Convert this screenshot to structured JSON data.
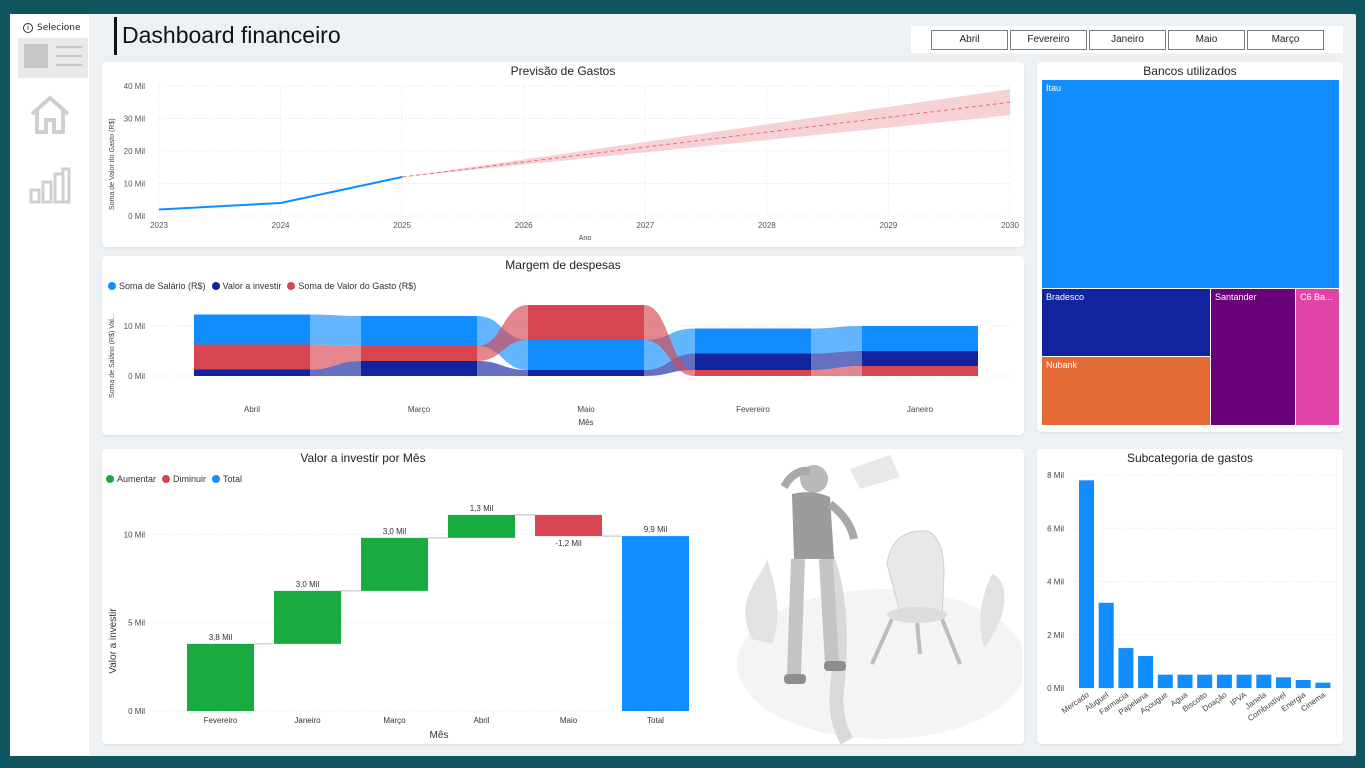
{
  "sidebar": {
    "select_label": "Selecione",
    "icons": [
      "home-icon",
      "bar-chart-icon"
    ]
  },
  "header": {
    "title": "Dashboard financeiro"
  },
  "month_filter": [
    "Abril",
    "Fevereiro",
    "Janeiro",
    "Maio",
    "Março"
  ],
  "chart_data": [
    {
      "id": "forecast",
      "type": "line",
      "title": "Previsão de Gastos",
      "xlabel": "Ano",
      "ylabel": "Soma de Valor do Gasto (R$)",
      "x": [
        2023,
        2024,
        2025
      ],
      "values": [
        2,
        4,
        12
      ],
      "forecast": {
        "x": [
          2025,
          2030
        ],
        "values": [
          12,
          35
        ],
        "lower": [
          12,
          31
        ],
        "upper": [
          12,
          39
        ]
      },
      "xticks": [
        "2023",
        "2024",
        "2025",
        "2026",
        "2027",
        "2028",
        "2029",
        "2030"
      ],
      "yticks": [
        "0 Mil",
        "10 Mil",
        "20 Mil",
        "30 Mil",
        "40 Mil"
      ],
      "ylim": [
        0,
        40
      ],
      "colors": {
        "line": "#118dff",
        "forecast": "#e66c7a",
        "band": "#f4c7cc"
      }
    },
    {
      "id": "ribbon",
      "type": "area",
      "title": "Margem de despesas",
      "xlabel": "Mês",
      "ylabel": "Soma de Salário (R$) Val...",
      "categories": [
        "Abril",
        "Março",
        "Maio",
        "Fevereiro",
        "Janeiro"
      ],
      "series": [
        {
          "name": "Soma de Salário (R$)",
          "color": "#118dff",
          "values": [
            6,
            6,
            6,
            5,
            5
          ]
        },
        {
          "name": "Valor a investir",
          "color": "#12239e",
          "values": [
            1.3,
            3,
            1.2,
            3.3,
            3
          ]
        },
        {
          "name": "Soma de Valor do Gasto (R$)",
          "color": "#d64550",
          "values": [
            5,
            3,
            7,
            1.2,
            2
          ]
        }
      ],
      "yticks": [
        "0 Mil",
        "10 Mil"
      ],
      "ylim": [
        -2,
        13
      ]
    },
    {
      "id": "waterfall",
      "type": "bar",
      "title": "Valor a investir por Mês",
      "xlabel": "Mês",
      "ylabel": "Valor a investir",
      "legend": [
        {
          "name": "Aumentar",
          "color": "#1aab40"
        },
        {
          "name": "Diminuir",
          "color": "#d64550"
        },
        {
          "name": "Total",
          "color": "#118dff"
        }
      ],
      "categories": [
        "Fevereiro",
        "Janeiro",
        "Março",
        "Abril",
        "Maio",
        "Total"
      ],
      "deltas": [
        3.8,
        3.0,
        3.0,
        1.3,
        -1.2,
        9.9
      ],
      "labels": [
        "3,8 Mil",
        "3,0 Mil",
        "3,0 Mil",
        "1,3 Mil",
        "-1,2 Mil",
        "9,9 Mil"
      ],
      "yticks": [
        "0 Mil",
        "5 Mil",
        "10 Mil"
      ],
      "ylim": [
        0,
        12
      ]
    },
    {
      "id": "treemap",
      "type": "heatmap",
      "title": "Bancos utilizados",
      "items": [
        {
          "name": "Itau",
          "color": "#118dff"
        },
        {
          "name": "Bradesco",
          "color": "#12239e"
        },
        {
          "name": "Nubank",
          "color": "#e66c37"
        },
        {
          "name": "Santander",
          "color": "#6b007b"
        },
        {
          "name": "C6 Ba...",
          "color": "#e044a7"
        }
      ]
    },
    {
      "id": "subcat",
      "type": "bar",
      "title": "Subcategoria de gastos",
      "categories": [
        "Mercado",
        "Aluguel",
        "Farmacia",
        "Papelaria",
        "Açougue",
        "Agua",
        "Biscoito",
        "Doação",
        "IPVA",
        "Janela",
        "Combustível",
        "Energia",
        "Cinema"
      ],
      "values": [
        7.8,
        3.2,
        1.5,
        1.2,
        0.5,
        0.5,
        0.5,
        0.5,
        0.5,
        0.5,
        0.4,
        0.3,
        0.2
      ],
      "yticks": [
        "0 Mil",
        "2 Mil",
        "4 Mil",
        "6 Mil",
        "8 Mil"
      ],
      "ylim": [
        0,
        8
      ],
      "color": "#118dff"
    }
  ]
}
